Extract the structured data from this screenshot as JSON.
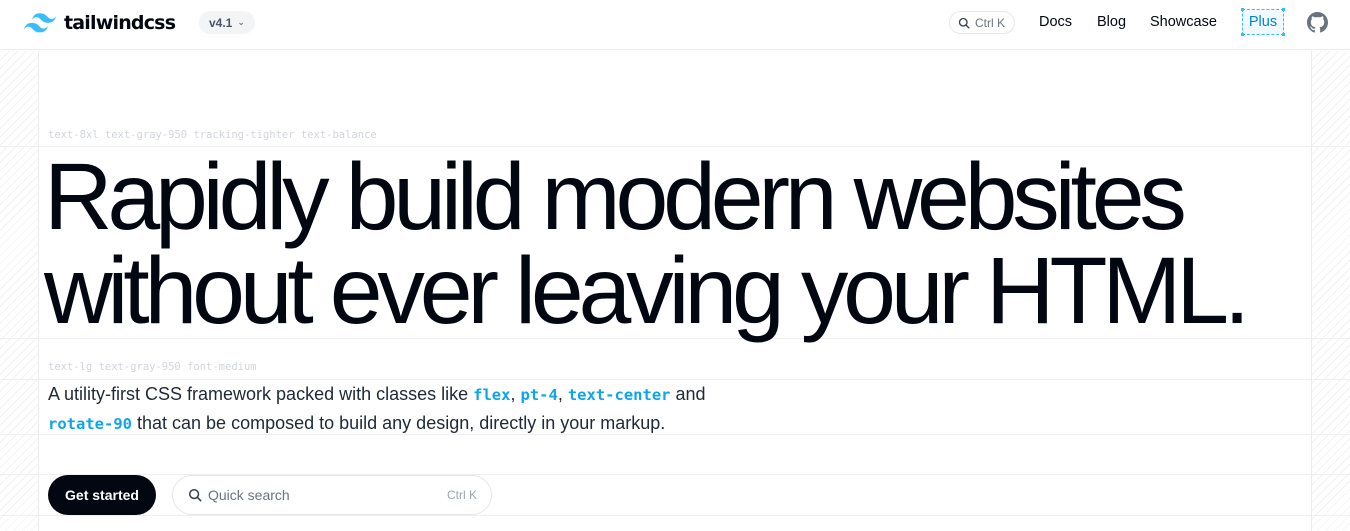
{
  "header": {
    "logo_text": "tailwindcss",
    "version": "v4.1",
    "search_shortcut": "Ctrl K",
    "nav": {
      "docs": "Docs",
      "blog": "Blog",
      "showcase": "Showcase",
      "plus": "Plus"
    },
    "github_icon": "github-icon"
  },
  "hero": {
    "headline_util": "text-8xl text-gray-950 tracking-tighter text-balance",
    "headline_line1": "Rapidly build modern websites",
    "headline_line2": "without ever leaving your HTML.",
    "lead_util": "text-lg text-gray-950 font-medium",
    "lead": {
      "part1": "A utility-first CSS framework packed with classes like ",
      "code1": "flex",
      "sep1": ", ",
      "code2": "pt-4",
      "sep2": ", ",
      "code3": "text-center",
      "part2": " and",
      "code4": "rotate-90",
      "part3": " that can be composed to build any design, directly in your markup."
    },
    "get_started": "Get started",
    "quick_search_placeholder": "Quick search",
    "quick_search_shortcut": "Ctrl K"
  },
  "colors": {
    "brand": "#38bdf8",
    "code": "#0ea5e9",
    "text": "#030712"
  }
}
